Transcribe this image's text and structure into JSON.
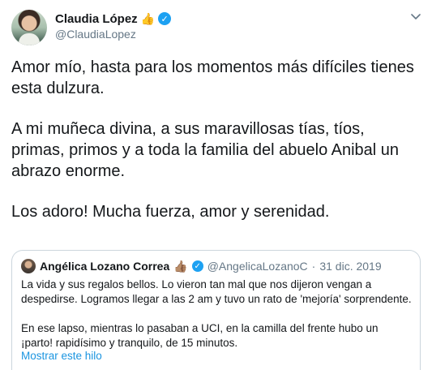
{
  "author": {
    "name": "Claudia López",
    "badge_emoji": "👍",
    "handle": "@ClaudiaLopez"
  },
  "icons": {
    "verified": "✓",
    "more": "chevron-down-icon"
  },
  "tweet": {
    "paragraphs": [
      "Amor mío, hasta para los momentos más difíciles tienes esta dulzura.",
      "A mi muñeca divina, a sus maravillosas tías, tíos, primas, primos y a toda la familia del abuelo Anibal un abrazo enorme.",
      "Los adoro! Mucha fuerza, amor y serenidad."
    ]
  },
  "quoted": {
    "name": "Angélica Lozano Correa",
    "badge_emoji": "👍🏽",
    "handle": "@AngelicaLozanoC",
    "separator": "·",
    "date": "31 dic. 2019",
    "paragraphs": [
      "La vida y sus regalos bellos. Lo vieron tan mal que nos dijeron vengan a despedirse. Logramos llegar a las 2 am y tuvo un rato de 'mejoría' sorprendente.",
      "En ese lapso, mientras lo pasaban a UCI, en la camilla del frente hubo un ¡parto! rapidísimo y tranquilo, de 15 minutos."
    ],
    "show_thread": "Mostrar este hilo"
  },
  "colors": {
    "link": "#1b95e0",
    "verified": "#1da1f2",
    "secondary_text": "#657786",
    "border": "#ccd6dd"
  }
}
